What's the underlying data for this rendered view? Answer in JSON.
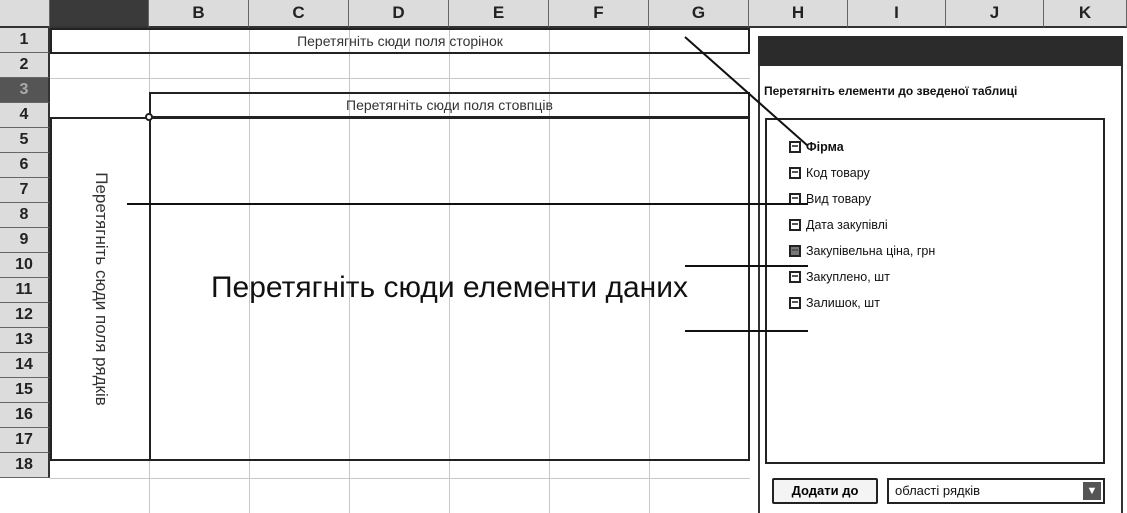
{
  "columns": [
    "",
    "B",
    "C",
    "D",
    "E",
    "F",
    "G",
    "H",
    "I",
    "J",
    "K"
  ],
  "rows": [
    "1",
    "2",
    "3",
    "4",
    "5",
    "6",
    "7",
    "8",
    "9",
    "10",
    "11",
    "12",
    "13",
    "14",
    "15",
    "16",
    "17",
    "18"
  ],
  "dropzones": {
    "page": "Перетягніть сюди поля сторінок",
    "column": "Перетягніть сюди поля стовпців",
    "row": "Перетягніть сюди поля рядків",
    "data": "Перетягніть сюди елементи даних"
  },
  "pivot_list": {
    "title": "Перетягніть елементи до зведеної таблиці",
    "fields": [
      {
        "label": "Фірма",
        "bold": true
      },
      {
        "label": "Код товару",
        "bold": false
      },
      {
        "label": "Вид товару",
        "bold": false
      },
      {
        "label": "Дата закупівлі",
        "bold": false
      },
      {
        "label": "Закупівельна ціна, грн",
        "bold": false
      },
      {
        "label": "Закуплено, шт",
        "bold": false
      },
      {
        "label": "Залишок, шт",
        "bold": false
      }
    ],
    "add_button": "Додати до",
    "area_select": "області рядків"
  },
  "colors": {
    "header_bg": "#dcdcdc",
    "panel_title_bar": "#2b2b2b",
    "selected_header": "#555555"
  }
}
